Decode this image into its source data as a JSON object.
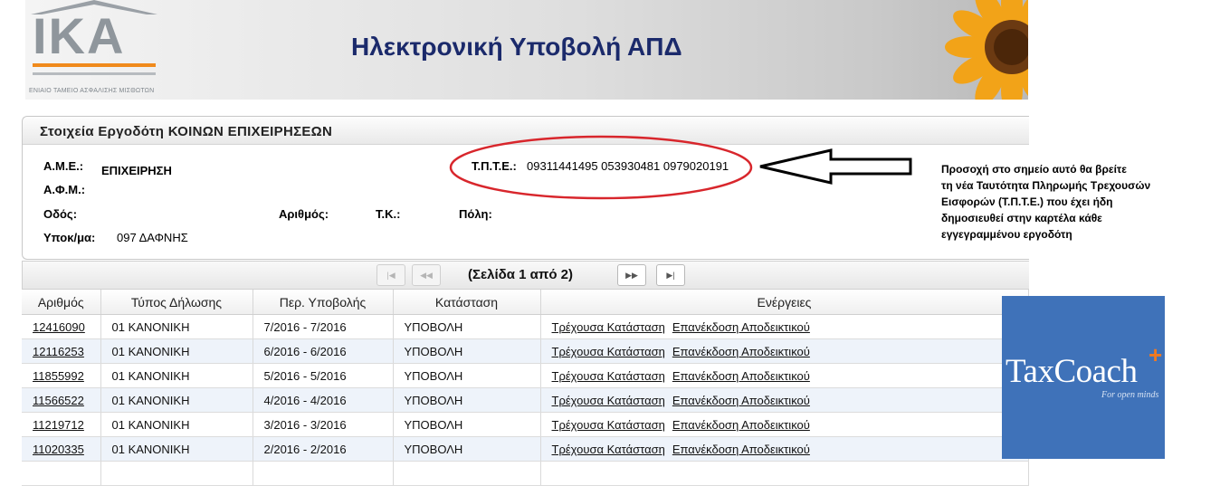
{
  "header": {
    "logo_text": "IKA",
    "logo_subtitle": "ΕΝΙΑΙΟ ΤΑΜΕΙΟ ΑΣΦΑΛΙΣΗΣ ΜΙΣΘΩΤΩΝ",
    "title": "Ηλεκτρονική Υποβολή ΑΠΔ"
  },
  "employer": {
    "panel_title": "Στοιχεία Εργοδότη ΚΟΙΝΩΝ ΕΠΙΧΕΙΡΗΣΕΩΝ",
    "ame_label": "Α.Μ.Ε.:",
    "ame_value": "ΕΠΙΧΕΙΡΗΣΗ",
    "afm_label": "Α.Φ.Μ.:",
    "afm_value": "",
    "street_label": "Οδός:",
    "number_label": "Αριθμός:",
    "tk_label": "Τ.Κ.:",
    "city_label": "Πόλη:",
    "branch_label": "Υποκ/μα:",
    "branch_value": "097 ΔΑΦΝΗΣ",
    "tpte_label": "Τ.Π.Τ.Ε.:",
    "tpte_value": "09311441495 053930481 0979020191"
  },
  "annotation": {
    "note_lines": [
      "Προσοχή στο σημείο αυτό θα βρείτε",
      "τη νέα Ταυτότητα Πληρωμής Τρεχουσών",
      "Εισφορών (Τ.Π.Τ.Ε.) που έχει ήδη",
      "δημοσιευθεί στην καρτέλα κάθε",
      "εγγεγραμμένου εργοδότη"
    ],
    "oval_color": "#d8262c",
    "arrow_color": "#000000"
  },
  "pager": {
    "info": "(Σελίδα 1 από 2)",
    "first_icon": "first-page-icon",
    "prev_icon": "prev-page-icon",
    "next_icon": "next-page-icon",
    "last_icon": "last-page-icon"
  },
  "table": {
    "headers": [
      "Αριθμός",
      "Τύπος Δήλωσης",
      "Περ. Υποβολής",
      "Κατάσταση",
      "Ενέργειες"
    ],
    "action_labels": [
      "Τρέχουσα Κατάσταση",
      "Επανέκδοση Αποδεικτικού"
    ],
    "rows": [
      {
        "num": "12416090",
        "type": "01 ΚΑΝΟΝΙΚΗ",
        "period": "7/2016 - 7/2016",
        "status": "ΥΠΟΒΟΛΗ"
      },
      {
        "num": "12116253",
        "type": "01 ΚΑΝΟΝΙΚΗ",
        "period": "6/2016 - 6/2016",
        "status": "ΥΠΟΒΟΛΗ"
      },
      {
        "num": "11855992",
        "type": "01 ΚΑΝΟΝΙΚΗ",
        "period": "5/2016 - 5/2016",
        "status": "ΥΠΟΒΟΛΗ"
      },
      {
        "num": "11566522",
        "type": "01 ΚΑΝΟΝΙΚΗ",
        "period": "4/2016 - 4/2016",
        "status": "ΥΠΟΒΟΛΗ"
      },
      {
        "num": "11219712",
        "type": "01 ΚΑΝΟΝΙΚΗ",
        "period": "3/2016 - 3/2016",
        "status": "ΥΠΟΒΟΛΗ"
      },
      {
        "num": "11020335",
        "type": "01 ΚΑΝΟΝΙΚΗ",
        "period": "2/2016 - 2/2016",
        "status": "ΥΠΟΒΟΛΗ"
      },
      {
        "num": "",
        "type": "",
        "period": "",
        "status": ""
      }
    ]
  },
  "taxcoach": {
    "brand": "TaxCoach",
    "plus": "+",
    "tagline": "For open minds",
    "bg_color": "#3f72b9",
    "accent_color": "#f07a22"
  }
}
